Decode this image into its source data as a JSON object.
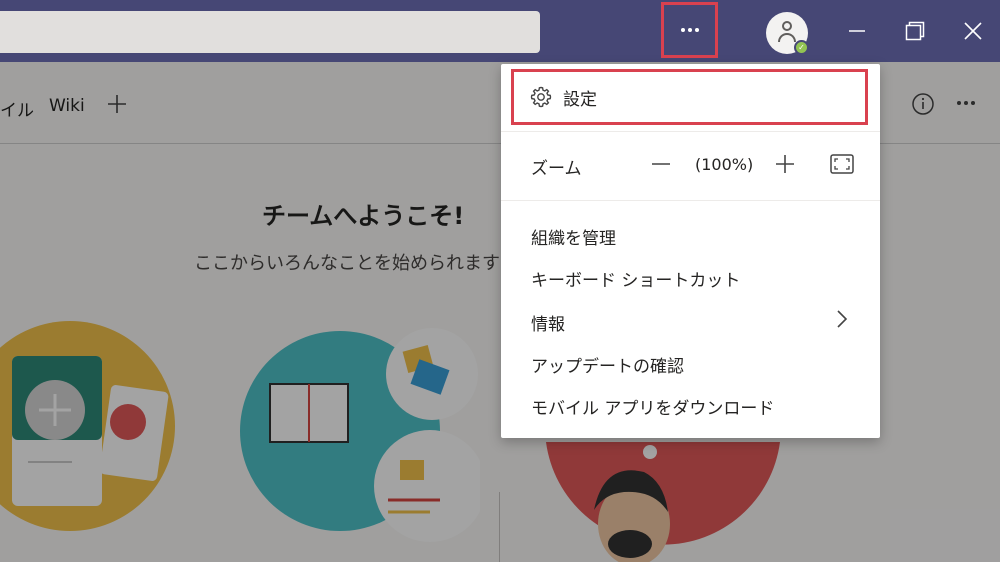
{
  "titlebar": {
    "more_icon": "more-horizontal-icon",
    "avatar_status_color": "#92c353",
    "window_controls": [
      "minimize",
      "restore",
      "close"
    ]
  },
  "tabs": {
    "partial_label": "イル",
    "wiki_label": "Wiki",
    "add_icon": "plus-icon"
  },
  "welcome": {
    "title": "チームへようこそ!",
    "subtitle": "ここからいろんなことを始められます"
  },
  "menu": {
    "settings_label": "設定",
    "zoom": {
      "label": "ズーム",
      "value": "(100%)"
    },
    "items": [
      "組織を管理",
      "キーボード ショートカット",
      "情報",
      "アップデートの確認",
      "モバイル アプリをダウンロード"
    ]
  },
  "colors": {
    "titlebar": "#464775",
    "highlight": "#d9414f"
  }
}
